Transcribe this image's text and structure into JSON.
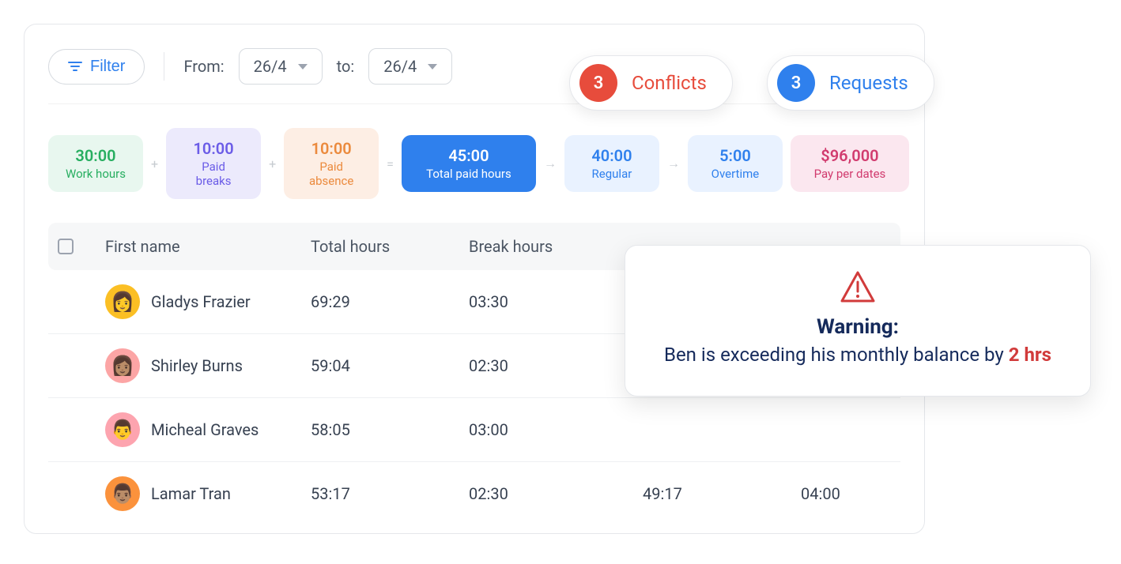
{
  "toolbar": {
    "filter_label": "Filter",
    "from_label": "From:",
    "from_value": "26/4",
    "to_label": "to:",
    "to_value": "26/4"
  },
  "pills": {
    "conflicts": {
      "count": "3",
      "label": "Conflicts"
    },
    "requests": {
      "count": "3",
      "label": "Requests"
    }
  },
  "stats": {
    "work": {
      "value": "30:00",
      "label": "Work hours"
    },
    "breaks": {
      "value": "10:00",
      "label": "Paid breaks"
    },
    "absence": {
      "value": "10:00",
      "label": "Paid absence"
    },
    "total": {
      "value": "45:00",
      "label": "Total paid hours"
    },
    "regular": {
      "value": "40:00",
      "label": "Regular"
    },
    "overtime": {
      "value": "5:00",
      "label": "Overtime"
    },
    "pay": {
      "value": "$96,000",
      "label": "Pay per dates"
    }
  },
  "ops": {
    "plus": "+",
    "eq": "=",
    "arrow": "→"
  },
  "table": {
    "headers": {
      "first_name": "First name",
      "total_hours": "Total hours",
      "break_hours": "Break hours"
    },
    "rows": [
      {
        "name": "Gladys Frazier",
        "total": "69:29",
        "break": "03:30",
        "col4": "",
        "col5": ""
      },
      {
        "name": "Shirley Burns",
        "total": "59:04",
        "break": "02:30",
        "col4": "",
        "col5": ""
      },
      {
        "name": "Micheal Graves",
        "total": "58:05",
        "break": "03:00",
        "col4": "",
        "col5": ""
      },
      {
        "name": "Lamar Tran",
        "total": "53:17",
        "break": "02:30",
        "col4": "49:17",
        "col5": "04:00"
      }
    ]
  },
  "warning": {
    "title": "Warning:",
    "body_prefix": "Ben is exceeding his monthly balance by ",
    "hrs": "2 hrs"
  }
}
